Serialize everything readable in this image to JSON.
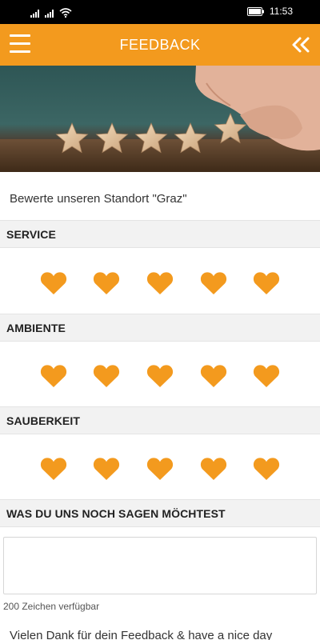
{
  "status_bar": {
    "time": "11:53"
  },
  "app_bar": {
    "title": "FEEDBACK",
    "menu_icon": "hamburger-menu-icon",
    "back_icon": "double-chevron-left-icon"
  },
  "hero": {
    "description": "five wooden stars photo"
  },
  "intro": "Bewerte unseren Standort \"Graz\"",
  "sections": [
    {
      "title": "SERVICE",
      "rating_max": 5
    },
    {
      "title": "AMBIENTE",
      "rating_max": 5
    },
    {
      "title": "SAUBERKEIT",
      "rating_max": 5
    }
  ],
  "comment": {
    "title": "WAS DU UNS NOCH SAGEN MÖCHTEST",
    "value": "",
    "char_count": "200 Zeichen verfügbar"
  },
  "thanks": "Vielen Dank für dein Feedback & have a nice day",
  "colors": {
    "accent": "#f39a1e",
    "heart": "#f39a1e",
    "status_bar": "#000000"
  }
}
